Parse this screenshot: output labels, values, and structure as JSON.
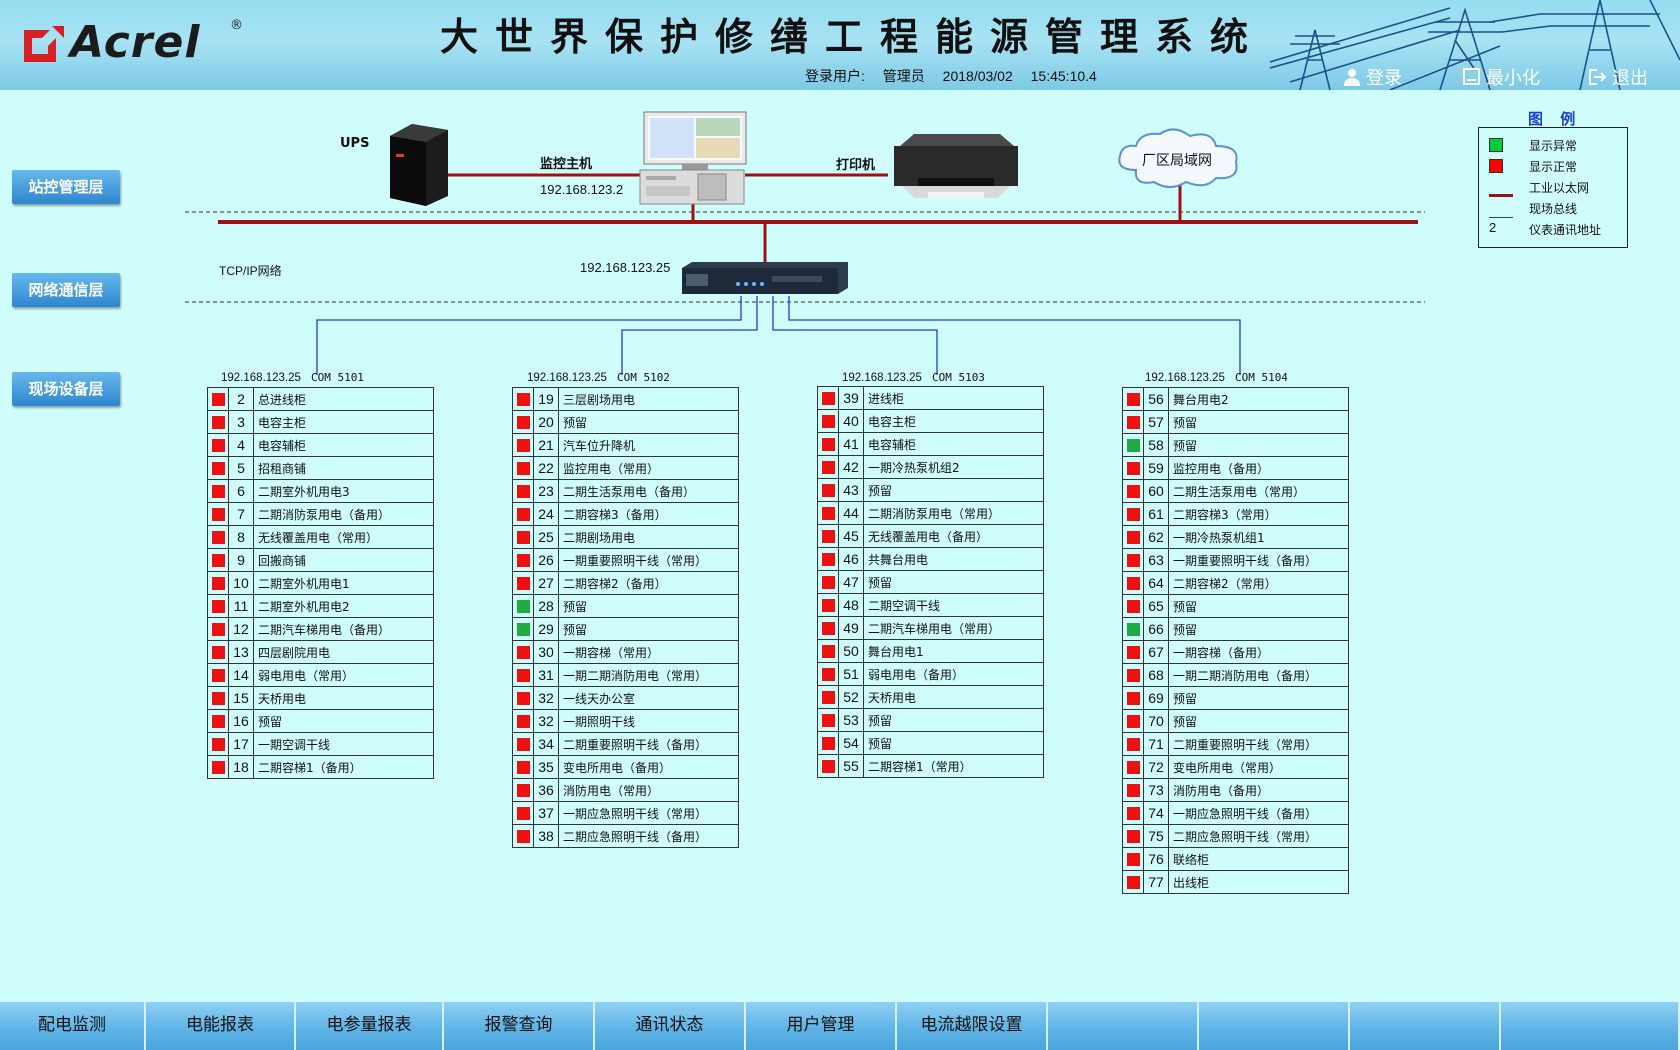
{
  "header": {
    "logo_text": "Acrel",
    "logo_reg": "®",
    "title": "大世界保护修缮工程能源管理系统",
    "user_label": "登录用户:",
    "user_name": "管理员",
    "date": "2018/03/02",
    "time": "15:45:10.4",
    "login_label": "登录",
    "minimize_label": "最小化",
    "exit_label": "退出"
  },
  "layers": {
    "station": "站控管理层",
    "network": "网络通信层",
    "field": "现场设备层"
  },
  "topology": {
    "ups_label": "UPS",
    "host_label": "监控主机",
    "host_ip": "192.168.123.2",
    "printer_label": "打印机",
    "lan_label": "厂区局域网",
    "tcpip_label": "TCP/IP网络",
    "switch_ip": "192.168.123.25"
  },
  "legend": {
    "title": "图 例",
    "items": [
      {
        "symbol": "square",
        "color": "#00cc33",
        "label": "显示异常"
      },
      {
        "symbol": "square",
        "color": "#ff0000",
        "label": "显示正常"
      },
      {
        "symbol": "line",
        "color": "#a01010",
        "label": "工业以太网"
      },
      {
        "symbol": "line",
        "color": "#1a3fd0",
        "label": "现场总线"
      },
      {
        "symbol": "text",
        "text": "2",
        "label": "仪表通讯地址"
      }
    ]
  },
  "colors": {
    "red": "#ee1111",
    "green": "#22aa44",
    "ethernet": "#a01010",
    "fieldbus": "#1a3fd0"
  },
  "tables": [
    {
      "ip": "192.168.123.25",
      "com": "COM 5101",
      "rows": [
        {
          "s": "red",
          "n": "2",
          "name": "总进线柜"
        },
        {
          "s": "red",
          "n": "3",
          "name": "电容主柜"
        },
        {
          "s": "red",
          "n": "4",
          "name": "电容辅柜"
        },
        {
          "s": "red",
          "n": "5",
          "name": "招租商铺"
        },
        {
          "s": "red",
          "n": "6",
          "name": "二期室外机用电3"
        },
        {
          "s": "red",
          "n": "7",
          "name": "二期消防泵用电（备用）"
        },
        {
          "s": "red",
          "n": "8",
          "name": "无线覆盖用电（常用）"
        },
        {
          "s": "red",
          "n": "9",
          "name": "回搬商铺"
        },
        {
          "s": "red",
          "n": "10",
          "name": "二期室外机用电1"
        },
        {
          "s": "red",
          "n": "11",
          "name": "二期室外机用电2"
        },
        {
          "s": "red",
          "n": "12",
          "name": "二期汽车梯用电（备用）"
        },
        {
          "s": "red",
          "n": "13",
          "name": "四层剧院用电"
        },
        {
          "s": "red",
          "n": "14",
          "name": "弱电用电（常用）"
        },
        {
          "s": "red",
          "n": "15",
          "name": "天桥用电"
        },
        {
          "s": "red",
          "n": "16",
          "name": "预留"
        },
        {
          "s": "red",
          "n": "17",
          "name": "一期空调干线"
        },
        {
          "s": "red",
          "n": "18",
          "name": "二期容梯1（备用）"
        }
      ]
    },
    {
      "ip": "192.168.123.25",
      "com": "COM 5102",
      "rows": [
        {
          "s": "red",
          "n": "19",
          "name": "三层剧场用电"
        },
        {
          "s": "red",
          "n": "20",
          "name": "预留"
        },
        {
          "s": "red",
          "n": "21",
          "name": "汽车位升降机"
        },
        {
          "s": "red",
          "n": "22",
          "name": "监控用电（常用）"
        },
        {
          "s": "red",
          "n": "23",
          "name": "二期生活泵用电（备用）"
        },
        {
          "s": "red",
          "n": "24",
          "name": "二期容梯3（备用）"
        },
        {
          "s": "red",
          "n": "25",
          "name": "二期剧场用电"
        },
        {
          "s": "red",
          "n": "26",
          "name": "一期重要照明干线（常用）"
        },
        {
          "s": "red",
          "n": "27",
          "name": "二期容梯2（备用）"
        },
        {
          "s": "green",
          "n": "28",
          "name": "预留"
        },
        {
          "s": "green",
          "n": "29",
          "name": "预留"
        },
        {
          "s": "red",
          "n": "30",
          "name": "一期容梯（常用）"
        },
        {
          "s": "red",
          "n": "31",
          "name": "一期二期消防用电（常用）"
        },
        {
          "s": "red",
          "n": "32",
          "name": "一线天办公室"
        },
        {
          "s": "red",
          "n": "32",
          "name": "一期照明干线"
        },
        {
          "s": "red",
          "n": "34",
          "name": "二期重要照明干线（备用）"
        },
        {
          "s": "red",
          "n": "35",
          "name": "变电所用电（备用）"
        },
        {
          "s": "red",
          "n": "36",
          "name": "消防用电（常用）"
        },
        {
          "s": "red",
          "n": "37",
          "name": "一期应急照明干线（常用）"
        },
        {
          "s": "red",
          "n": "38",
          "name": "二期应急照明干线（备用）"
        }
      ]
    },
    {
      "ip": "192.168.123.25",
      "com": "COM 5103",
      "rows": [
        {
          "s": "red",
          "n": "39",
          "name": "进线柜"
        },
        {
          "s": "red",
          "n": "40",
          "name": "电容主柜"
        },
        {
          "s": "red",
          "n": "41",
          "name": "电容辅柜"
        },
        {
          "s": "red",
          "n": "42",
          "name": "一期冷热泵机组2"
        },
        {
          "s": "red",
          "n": "43",
          "name": "预留"
        },
        {
          "s": "red",
          "n": "44",
          "name": "二期消防泵用电（常用）"
        },
        {
          "s": "red",
          "n": "45",
          "name": "无线覆盖用电（备用）"
        },
        {
          "s": "red",
          "n": "46",
          "name": "共舞台用电"
        },
        {
          "s": "red",
          "n": "47",
          "name": "预留"
        },
        {
          "s": "red",
          "n": "48",
          "name": "二期空调干线"
        },
        {
          "s": "red",
          "n": "49",
          "name": "二期汽车梯用电（常用）"
        },
        {
          "s": "red",
          "n": "50",
          "name": "舞台用电1"
        },
        {
          "s": "red",
          "n": "51",
          "name": "弱电用电（备用）"
        },
        {
          "s": "red",
          "n": "52",
          "name": "天桥用电"
        },
        {
          "s": "red",
          "n": "53",
          "name": "预留"
        },
        {
          "s": "red",
          "n": "54",
          "name": "预留"
        },
        {
          "s": "red",
          "n": "55",
          "name": "二期容梯1（常用）"
        }
      ]
    },
    {
      "ip": "192.168.123.25",
      "com": "COM 5104",
      "rows": [
        {
          "s": "red",
          "n": "56",
          "name": "舞台用电2"
        },
        {
          "s": "red",
          "n": "57",
          "name": "预留"
        },
        {
          "s": "green",
          "n": "58",
          "name": "预留"
        },
        {
          "s": "red",
          "n": "59",
          "name": "监控用电（备用）"
        },
        {
          "s": "red",
          "n": "60",
          "name": "二期生活泵用电（常用）"
        },
        {
          "s": "red",
          "n": "61",
          "name": "二期容梯3（常用）"
        },
        {
          "s": "red",
          "n": "62",
          "name": "一期冷热泵机组1"
        },
        {
          "s": "red",
          "n": "63",
          "name": "一期重要照明干线（备用）"
        },
        {
          "s": "red",
          "n": "64",
          "name": "二期容梯2（常用）"
        },
        {
          "s": "red",
          "n": "65",
          "name": "预留"
        },
        {
          "s": "green",
          "n": "66",
          "name": "预留"
        },
        {
          "s": "red",
          "n": "67",
          "name": "一期容梯（备用）"
        },
        {
          "s": "red",
          "n": "68",
          "name": "一期二期消防用电（备用）"
        },
        {
          "s": "red",
          "n": "69",
          "name": "预留"
        },
        {
          "s": "red",
          "n": "70",
          "name": "预留"
        },
        {
          "s": "red",
          "n": "71",
          "name": "二期重要照明干线（常用）"
        },
        {
          "s": "red",
          "n": "72",
          "name": "变电所用电（常用）"
        },
        {
          "s": "red",
          "n": "73",
          "name": "消防用电（备用）"
        },
        {
          "s": "red",
          "n": "74",
          "name": "一期应急照明干线（备用）"
        },
        {
          "s": "red",
          "n": "75",
          "name": "二期应急照明干线（常用）"
        },
        {
          "s": "red",
          "n": "76",
          "name": "联络柜"
        },
        {
          "s": "red",
          "n": "77",
          "name": "出线柜"
        }
      ]
    }
  ],
  "nav": [
    "配电监测",
    "电能报表",
    "电参量报表",
    "报警查询",
    "通讯状态",
    "用户管理",
    "电流越限设置",
    "",
    "",
    "",
    "",
    ""
  ]
}
